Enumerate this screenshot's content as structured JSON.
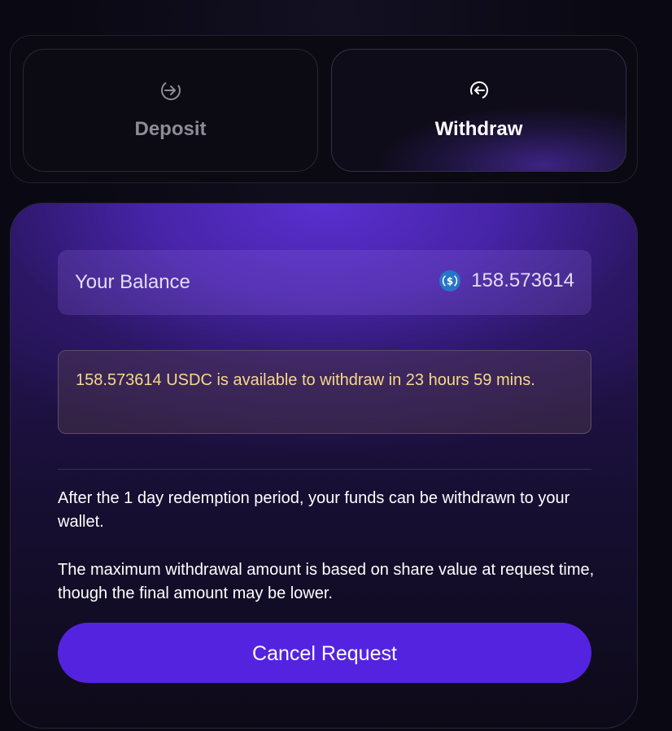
{
  "tabs": {
    "deposit": {
      "label": "Deposit",
      "icon": "arrow-in-circle-icon"
    },
    "withdraw": {
      "label": "Withdraw",
      "icon": "arrow-out-circle-icon",
      "active": true
    }
  },
  "balance": {
    "label": "Your Balance",
    "value": "158.573614",
    "token_icon": "usdc-icon"
  },
  "notice": {
    "text": "158.573614 USDC is available to withdraw in 23 hours 59 mins."
  },
  "info": {
    "paragraph_1": "After the 1 day redemption period, your funds can be withdrawn to your wallet.",
    "paragraph_2": "The maximum withdrawal amount is based on share value at request time, though the final amount may be lower."
  },
  "actions": {
    "cancel_label": "Cancel Request"
  },
  "colors": {
    "accent": "#5423e0",
    "notice_text": "#f7d88a",
    "usdc_blue": "#2775ca"
  }
}
